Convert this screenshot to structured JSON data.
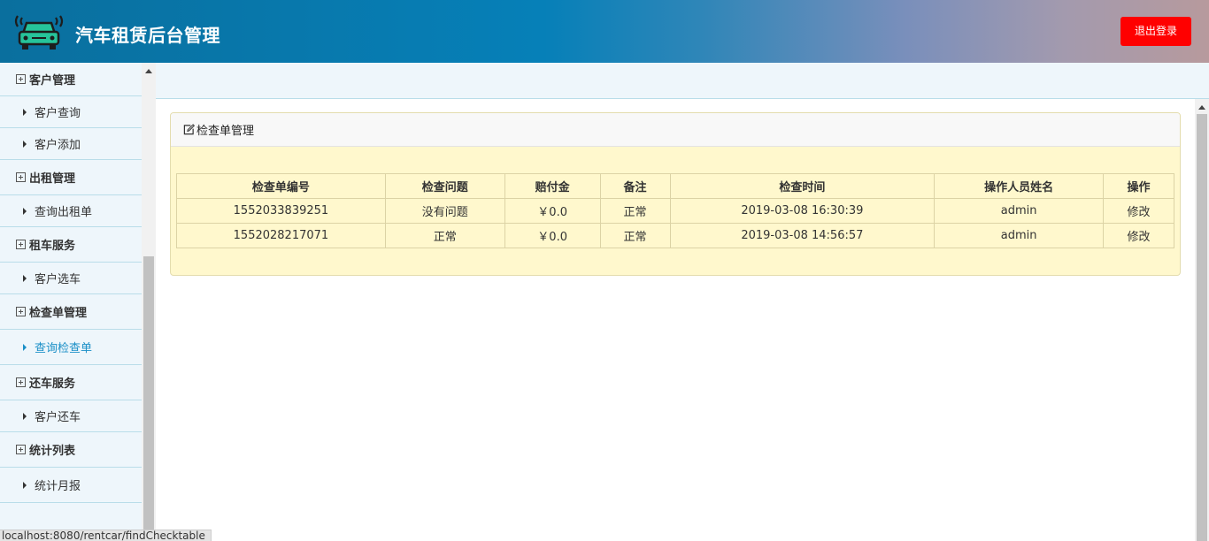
{
  "header": {
    "title": "汽车租赁后台管理",
    "logout_label": "退出登录",
    "logo_icon": "car-signal-icon",
    "logo_color": "#26c49a"
  },
  "sidebar": {
    "groups": [
      {
        "label": "客户管理",
        "items": [
          "客户查询",
          "客户添加"
        ]
      },
      {
        "label": "出租管理",
        "items": [
          "查询出租单"
        ]
      },
      {
        "label": "租车服务",
        "items": [
          "客户选车"
        ]
      },
      {
        "label": "检查单管理",
        "items": [
          "查询检查单"
        ]
      },
      {
        "label": "还车服务",
        "items": [
          "客户还车"
        ]
      },
      {
        "label": "统计列表",
        "items": [
          "统计月报"
        ]
      }
    ],
    "active_item": "查询检查单",
    "active_color": "#1a8fc7"
  },
  "panel": {
    "title": "检查单管理",
    "icon": "edit-icon",
    "columns": [
      "检查单编号",
      "检查问题",
      "赔付金",
      "备注",
      "检查时间",
      "操作人员姓名",
      "操作"
    ],
    "rows": [
      [
        "1552033839251",
        "没有问题",
        "￥0.0",
        "正常",
        "2019-03-08 16:30:39",
        "admin",
        "修改"
      ],
      [
        "1552028217071",
        "正常",
        "￥0.0",
        "正常",
        "2019-03-08 14:56:57",
        "admin",
        "修改"
      ]
    ]
  },
  "status_bar": {
    "url": "localhost:8080/rentcar/findChecktable"
  },
  "colors": {
    "logout_bg": "#ff0000",
    "panel_bg": "#fff8cd",
    "sidebar_bg": "#eef6fb"
  }
}
